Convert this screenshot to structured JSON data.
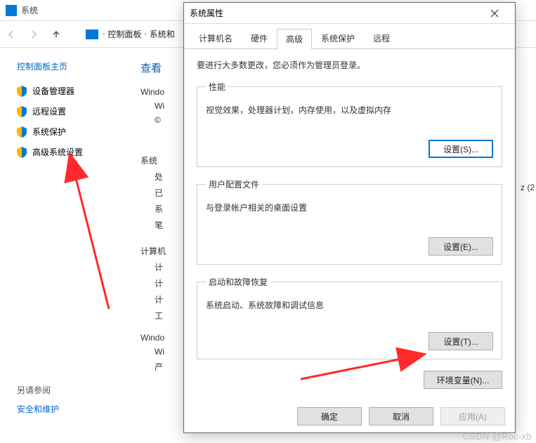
{
  "bg": {
    "title": "系统",
    "breadcrumbs": [
      "控制面板",
      "系统和"
    ],
    "cp_home": "控制面板主页",
    "side_links": [
      "设备管理器",
      "远程设置",
      "系统保护",
      "高级系统设置"
    ],
    "section_header": "查看",
    "line_windows": "Windo",
    "line_win": "Wi",
    "line_copy": "©",
    "grp_system": "系统",
    "sys_lines": [
      "处",
      "已",
      "系",
      "笔"
    ],
    "grp_pc": "计算机",
    "pc_lines": [
      "计",
      "计",
      "计",
      "工"
    ],
    "grp_win2": "Windo",
    "win2_lines": [
      "Wi",
      "产"
    ],
    "seealso": "另请参阅",
    "seealso_link": "安全和维护",
    "cutoff": "z (2"
  },
  "dlg": {
    "title": "系统属性",
    "tabs": [
      "计算机名",
      "硬件",
      "高级",
      "系统保护",
      "远程"
    ],
    "intro": "要进行大多数更改，您必须作为管理员登录。",
    "groups": [
      {
        "legend": "性能",
        "desc": "视觉效果，处理器计划，内存使用，以及虚拟内存",
        "btn": "设置(S)...",
        "highlight": true
      },
      {
        "legend": "用户配置文件",
        "desc": "与登录帐户相关的桌面设置",
        "btn": "设置(E)..."
      },
      {
        "legend": "启动和故障恢复",
        "desc": "系统启动、系统故障和调试信息",
        "btn": "设置(T)..."
      }
    ],
    "env_btn": "环境变量(N)...",
    "ok": "确定",
    "cancel": "取消",
    "apply": "应用(A)"
  },
  "watermark": "CSDN @Roc-xb"
}
